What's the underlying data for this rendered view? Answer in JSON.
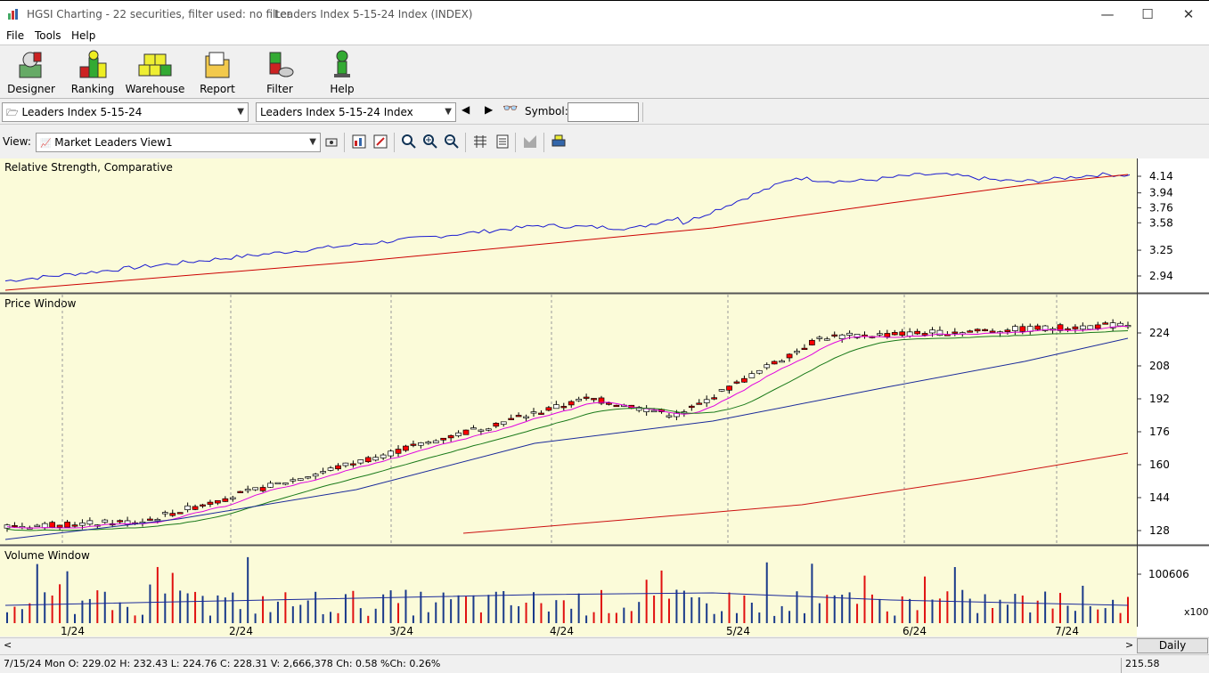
{
  "window": {
    "title": "HGSI Charting - 22 securities, filter used: no filter",
    "subtitle": "Leaders Index 5-15-24 Index (INDEX)",
    "min": "—",
    "max": "☐",
    "close": "✕"
  },
  "menu": [
    "File",
    "Tools",
    "Help"
  ],
  "toolbar": [
    {
      "label": "Designer",
      "icon": "designer-icon"
    },
    {
      "label": "Ranking",
      "icon": "ranking-icon"
    },
    {
      "label": "Warehouse",
      "icon": "warehouse-icon"
    },
    {
      "label": "Report",
      "icon": "report-icon"
    },
    {
      "label": "Filter",
      "icon": "filter-icon"
    },
    {
      "label": "Help",
      "icon": "help-icon"
    }
  ],
  "selectors": {
    "list": "Leaders Index 5-15-24",
    "security": "Leaders Index 5-15-24 Index",
    "symbol_label": "Symbol:",
    "symbol_value": ""
  },
  "view": {
    "label": "View:",
    "value": "Market Leaders View1"
  },
  "panels": {
    "rs": {
      "title": "Relative Strength, Comparative",
      "ticks": [
        "4.14",
        "3.94",
        "3.76",
        "3.58",
        "3.25",
        "2.94"
      ]
    },
    "price": {
      "title": "Price Window",
      "ticks": [
        "224",
        "208",
        "192",
        "176",
        "160",
        "144",
        "128"
      ]
    },
    "volume": {
      "title": "Volume Window",
      "ticks": [
        "100606"
      ],
      "multiplier": "x100"
    }
  },
  "x_labels": [
    "1/24",
    "2/24",
    "3/24",
    "4/24",
    "5/24",
    "6/24",
    "7/24"
  ],
  "period": "Daily",
  "status": {
    "left": "7/15/24 Mon O: 229.02 H: 232.43 L: 224.76 C: 228.31 V: 2,666,378 Ch: 0.58 %Ch: 0.26%",
    "right": "215.58"
  },
  "colors": {
    "chart_bg": "#fbfbd9",
    "up": "#ffffff",
    "down": "#ff0000",
    "rs_line": "#1a1ad0",
    "rs_ma": "#cc0000",
    "ma_pink": "#e000e0",
    "ma_green": "#1a7a1a",
    "ma_blue": "#1a2a9a",
    "ma_red": "#cc1010"
  }
}
